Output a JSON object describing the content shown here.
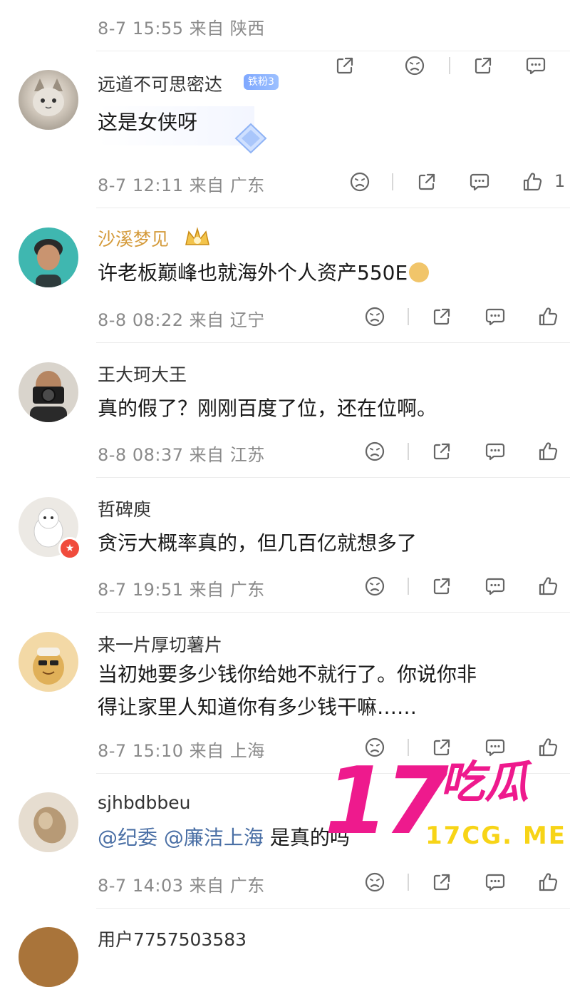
{
  "comments": [
    {
      "meta": "8-7 15:55 来自 陕西"
    },
    {
      "user": "远道不可思密达",
      "badge": "铁粉3",
      "text": "这是女侠呀",
      "meta": "8-7 12:11 来自 广东",
      "likes": "1"
    },
    {
      "user": "沙溪梦见",
      "text": "许老板巅峰也就海外个人资产550E",
      "meta": "8-8 08:22 来自 辽宁"
    },
    {
      "user": "王大珂大王",
      "text": "真的假了？刚刚百度了位，还在位啊。",
      "meta": "8-8 08:37 来自 江苏"
    },
    {
      "user": "哲碑庾",
      "text": "贪污大概率真的，但几百亿就想多了",
      "meta": "8-7 19:51 来自 广东"
    },
    {
      "user": "来一片厚切薯片",
      "text_line1": "当初她要多少钱你给她不就行了。你说你非",
      "text_line2": "得让家里人知道你有多少钱干嘛……",
      "meta": "8-7 15:10 来自 上海"
    },
    {
      "user": "sjhbdbbeu",
      "mention1": "@纪委",
      "mention2": "@廉洁上海",
      "text_tail": "是真的吗",
      "meta": "8-7 14:03 来自 广东"
    },
    {
      "user": "用户7757503583"
    }
  ],
  "watermark": {
    "big": "17",
    "cn": "吃瓜",
    "url": "17CG. ME"
  },
  "icons": [
    "share-icon",
    "dislike-icon",
    "comment-icon",
    "like-icon"
  ],
  "colors": {
    "gold_name": "#d49a3a",
    "link": "#4a6fa5",
    "watermark_pink": "#ee1a8d",
    "watermark_yellow": "#f7d417"
  }
}
